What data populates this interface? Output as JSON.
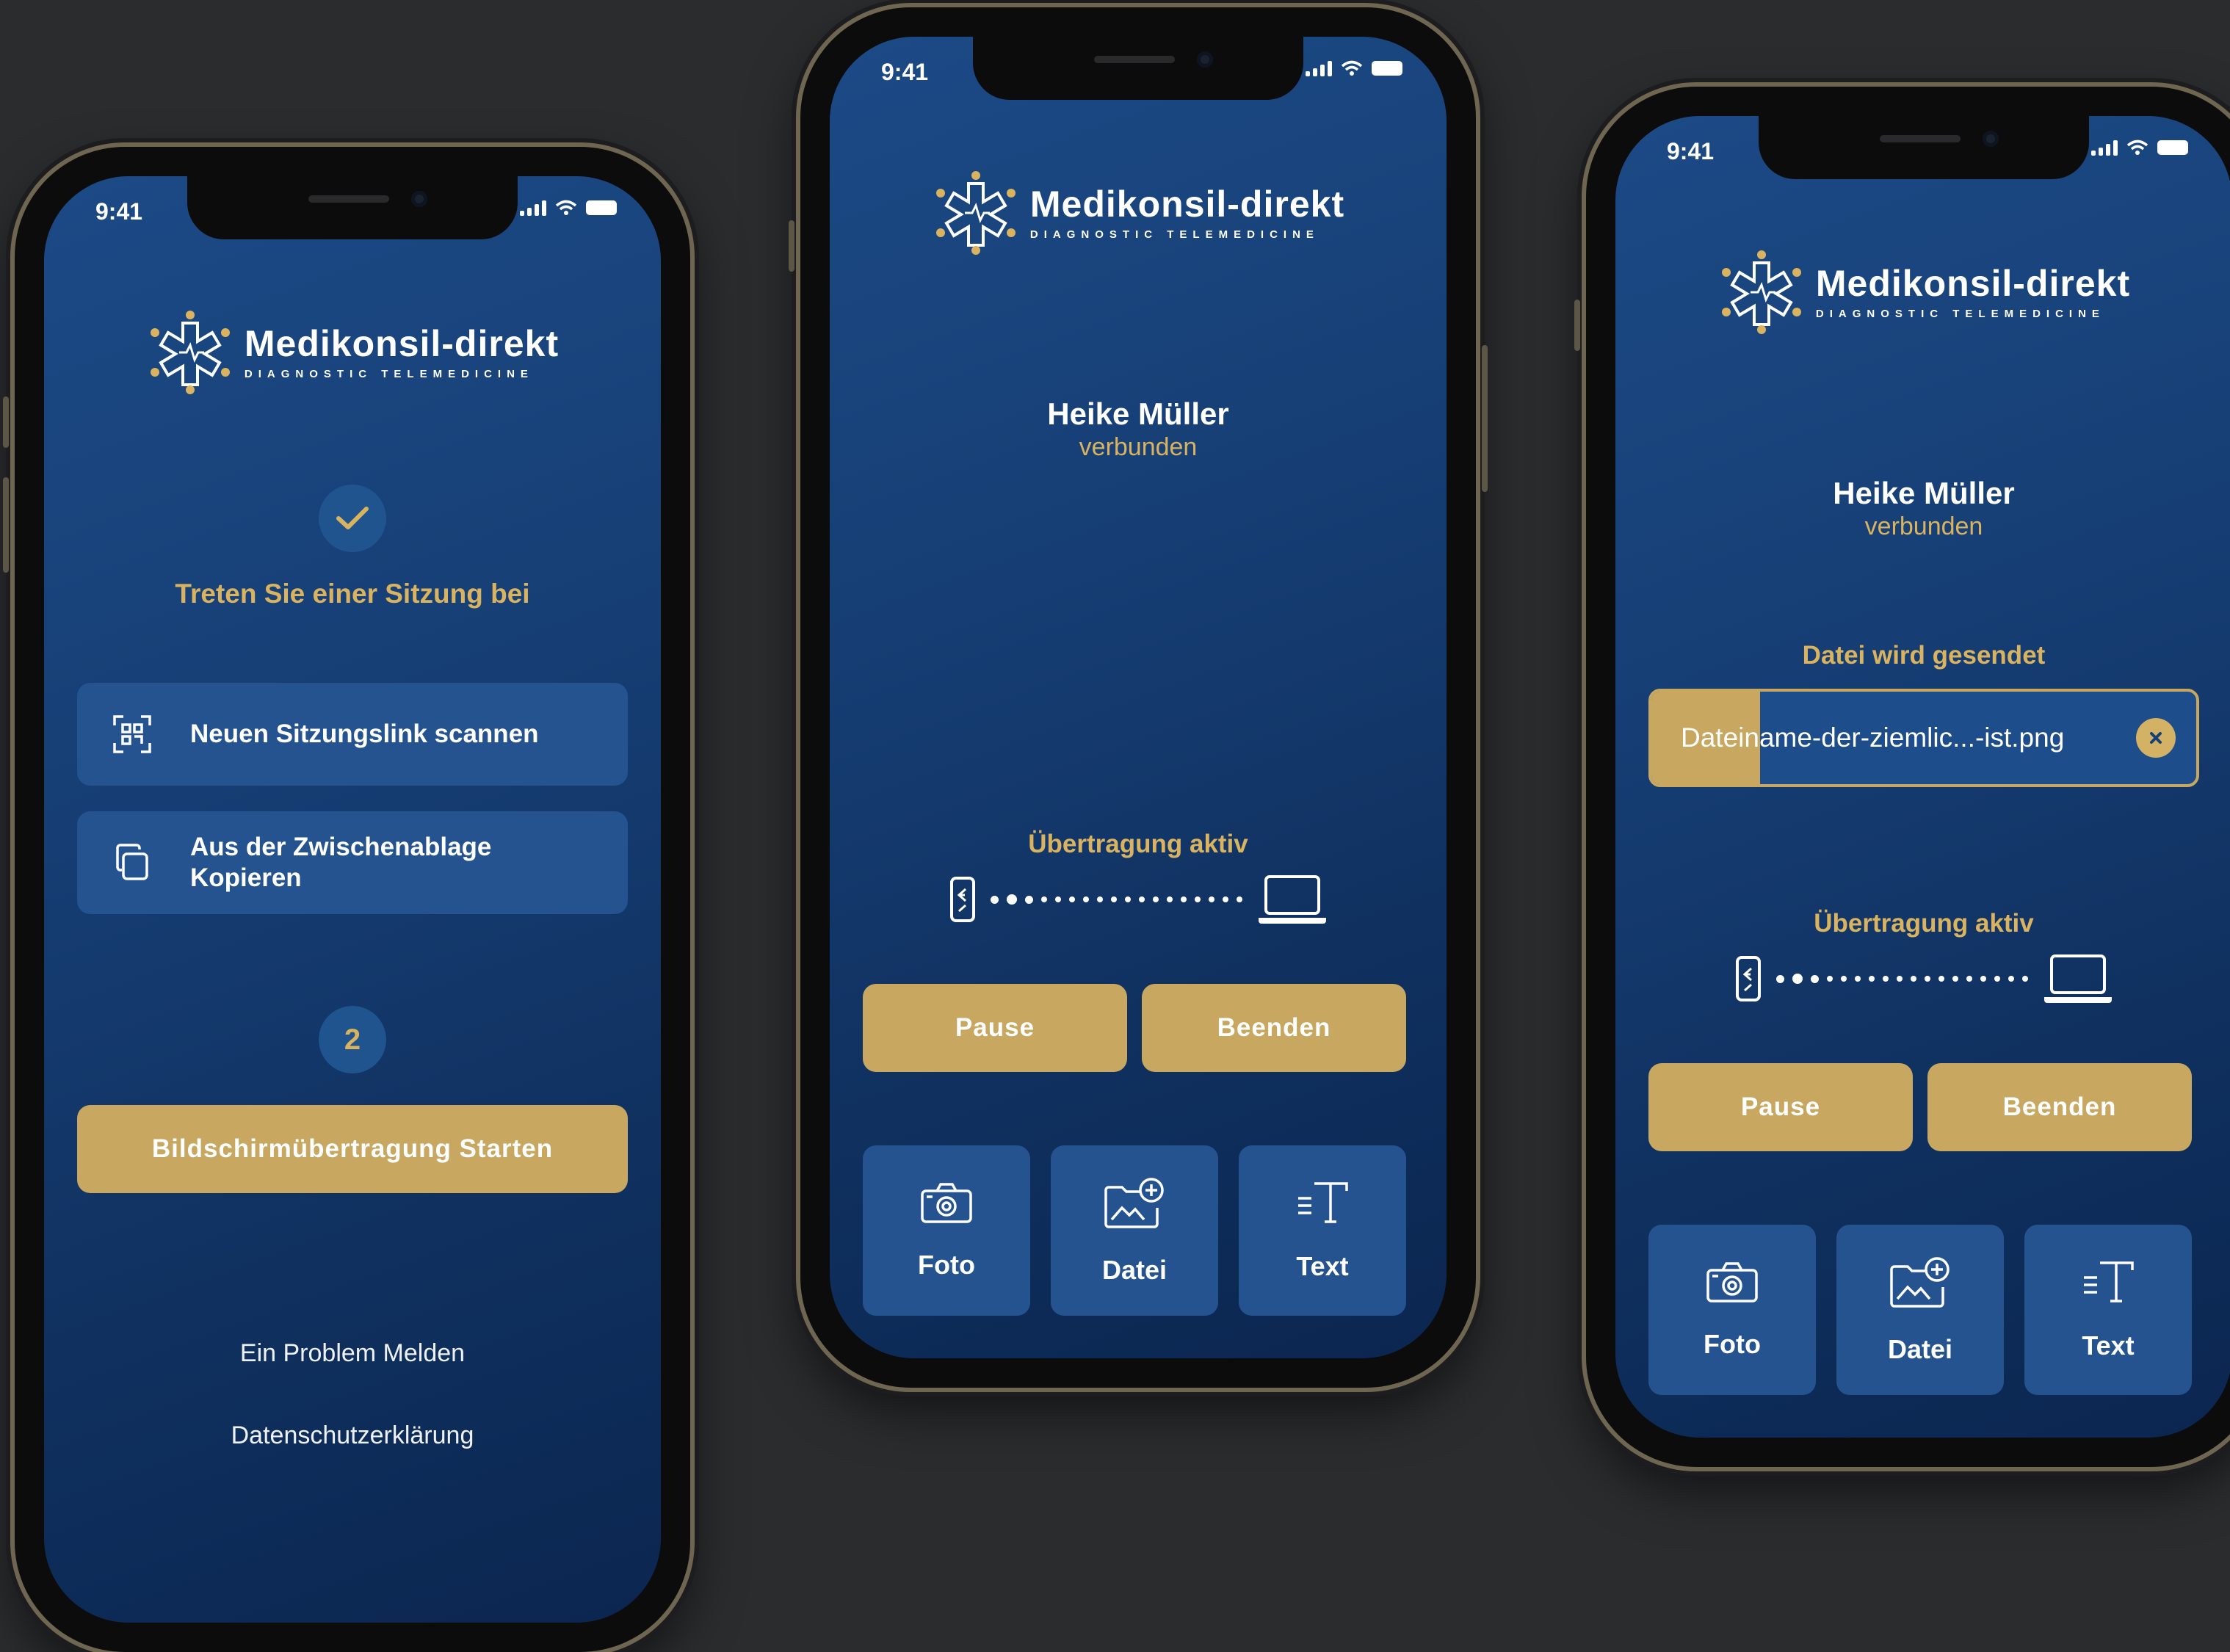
{
  "status_time": "9:41",
  "logo": {
    "name": "Medikonsil-direkt",
    "subtitle": "DIAGNOSTIC TELEMEDICINE"
  },
  "colors": {
    "accent_gold": "#c8a860",
    "panel_blue": "#245390",
    "bg_dark": "#2b2c2e"
  },
  "screen1": {
    "step1_icon": "checkmark-icon",
    "heading": "Treten Sie einer Sitzung bei",
    "scan_button": {
      "icon": "qr-scan-icon",
      "label": "Neuen Sitzungslink scannen"
    },
    "clipboard_button": {
      "icon": "copy-icon",
      "label_line1": "Aus der Zwischenablage",
      "label_line2": "Kopieren"
    },
    "step2_number": "2",
    "start_button": "Bildschirmübertragung Starten",
    "report_link": "Ein Problem Melden",
    "privacy_link": "Datenschutzerklärung"
  },
  "screen2": {
    "contact_name": "Heike Müller",
    "contact_status": "verbunden",
    "transfer_label": "Übertragung aktiv",
    "pause_button": "Pause",
    "end_button": "Beenden",
    "tiles": [
      "Foto",
      "Datei",
      "Text"
    ]
  },
  "screen3": {
    "contact_name": "Heike Müller",
    "contact_status": "verbunden",
    "sending_label": "Datei wird gesendet",
    "file_name": "Dateiname-der-ziemlic...-ist.png",
    "file_progress": 0.2,
    "transfer_label": "Übertragung aktiv",
    "pause_button": "Pause",
    "end_button": "Beenden",
    "tiles": [
      "Foto",
      "Datei",
      "Text"
    ]
  }
}
